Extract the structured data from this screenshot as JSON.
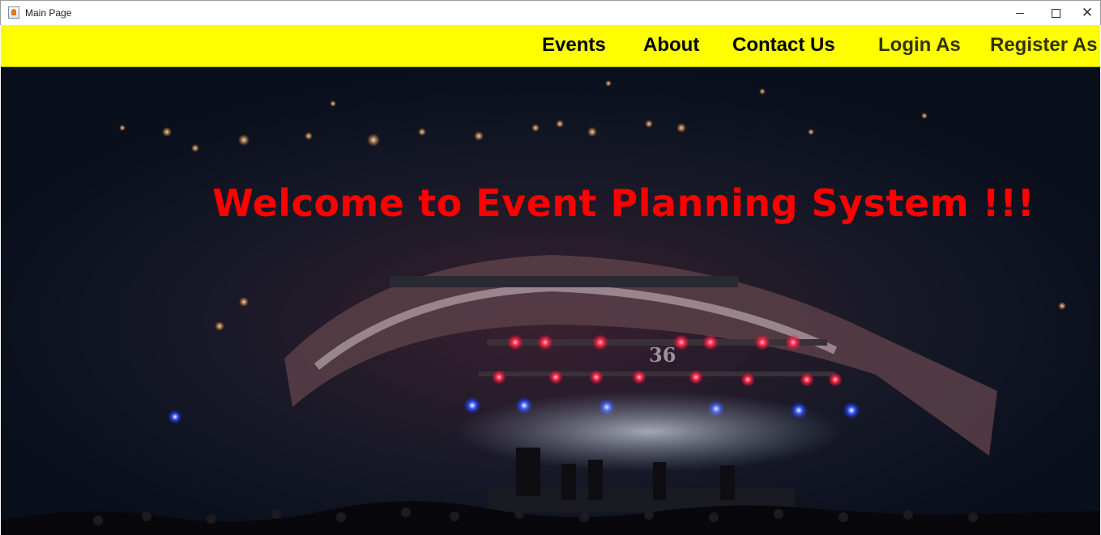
{
  "window": {
    "title": "Main Page",
    "controls": {
      "minimize": "minimize",
      "maximize": "maximize",
      "close": "close"
    }
  },
  "nav": {
    "items": [
      {
        "label": "Events"
      },
      {
        "label": "About"
      },
      {
        "label": "Contact Us"
      },
      {
        "label": "Login As"
      },
      {
        "label": "Register As"
      }
    ],
    "background": "#ffff00"
  },
  "hero": {
    "heading": "Welcome to Event Planning System !!!",
    "heading_color": "#ff0000",
    "image": "concert-stage-photo",
    "stage_sign": "36"
  }
}
